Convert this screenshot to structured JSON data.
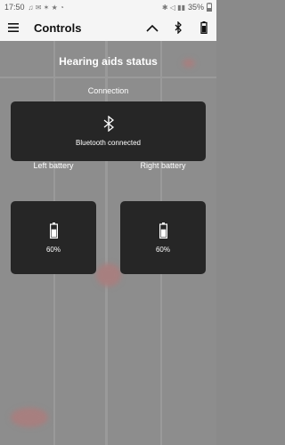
{
  "status_bar": {
    "time": "17:50",
    "battery_percent": "35%"
  },
  "app_bar": {
    "title": "Controls",
    "menu_icon": "hamburger-menu-icon",
    "actions": [
      "chevron-up-icon",
      "bluetooth-icon",
      "battery-icon"
    ]
  },
  "dialog": {
    "title": "Hearing aids status",
    "connection": {
      "label": "Connection",
      "status": "Bluetooth connected",
      "icon": "bluetooth-icon"
    },
    "left_battery": {
      "label": "Left battery",
      "value": "60%",
      "level": 0.6
    },
    "right_battery": {
      "label": "Right battery",
      "value": "60%",
      "level": 0.6
    }
  },
  "colors": {
    "card_background": "#262626",
    "backdrop": "#8d8d8d"
  }
}
